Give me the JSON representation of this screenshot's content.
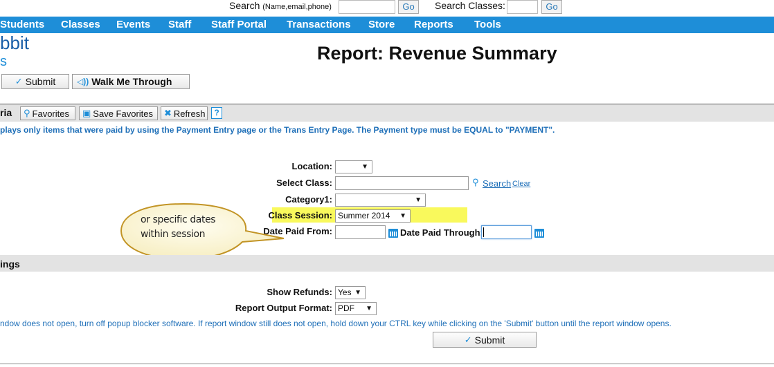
{
  "topbar": {
    "search_label": "Search",
    "search_hint": "(Name,email,phone)",
    "go1": "Go",
    "search_classes_label": "Search Classes:",
    "go2": "Go"
  },
  "nav": {
    "items": [
      "Students",
      "Classes",
      "Events",
      "Staff",
      "Staff Portal",
      "Transactions",
      "Store",
      "Reports",
      "Tools"
    ]
  },
  "logo": {
    "text": "bbit",
    "sub": "s"
  },
  "page": {
    "title": "Report: Revenue Summary",
    "submit_label": "Submit",
    "walk_label": "Walk Me Through"
  },
  "criteria": {
    "title": "ria",
    "favorites": "Favorites",
    "save_favorites": "Save Favorites",
    "refresh": "Refresh",
    "help": "?",
    "note": "plays only items that were paid by using the Payment Entry page or the Trans Entry Page. The Payment type must be EQUAL to \"PAYMENT\"."
  },
  "form": {
    "location_label": "Location:",
    "location_value": "",
    "select_class_label": "Select Class:",
    "search_link": "Search",
    "clear_link": "Clear",
    "category_label": "Category1:",
    "category_value": "",
    "class_session_label": "Class Session:",
    "class_session_value": "Summer 2014",
    "date_paid_from_label": "Date Paid From:",
    "date_paid_through_label": "Date Paid Through:"
  },
  "callout": {
    "line1": "or specific dates",
    "line2": "within session"
  },
  "settings": {
    "title": "ings",
    "show_refunds_label": "Show Refunds:",
    "show_refunds_value": "Yes",
    "output_format_label": "Report Output Format:",
    "output_format_value": "PDF",
    "note": "ndow does not open, turn off popup blocker software. If report window still does not open, hold down your CTRL key while clicking on the 'Submit' button until the report window opens.",
    "submit_label": "Submit"
  },
  "colors": {
    "nav": "#1e8ed8",
    "highlight": "#f9f95c",
    "link": "#1e6fb8"
  },
  "icons": [
    "checkmark-icon",
    "megaphone-icon",
    "magnifier-icon",
    "save-icon",
    "close-x-icon",
    "help-icon",
    "calendar-icon",
    "dropdown-arrow-icon"
  ]
}
